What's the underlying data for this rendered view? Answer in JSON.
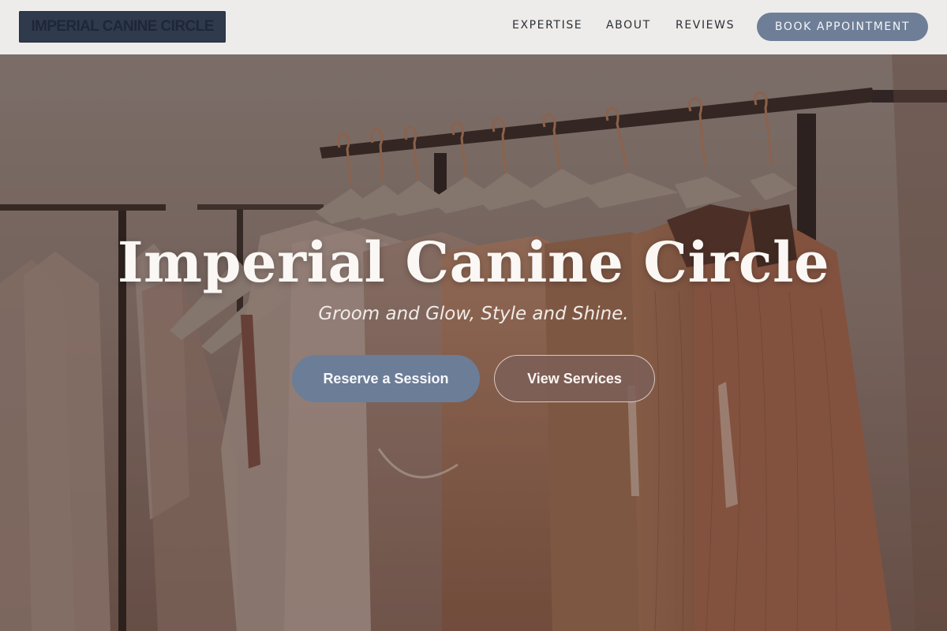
{
  "nav": {
    "logo": "IMPERIAL CANINE CIRCLE",
    "links": [
      "EXPERTISE",
      "ABOUT",
      "REVIEWS"
    ],
    "book_label": "BOOK APPOINTMENT"
  },
  "hero": {
    "title": "Imperial Canine Circle",
    "subtitle": "Groom and Glow, Style and Shine.",
    "primary_button": "Reserve a Session",
    "secondary_button": "View Services"
  },
  "colors": {
    "navbar_bg": "#edecea",
    "logo_bg": "#2f3a4d",
    "accent": "#6c7d98",
    "secondary_button_bg": "#7d5f58"
  }
}
